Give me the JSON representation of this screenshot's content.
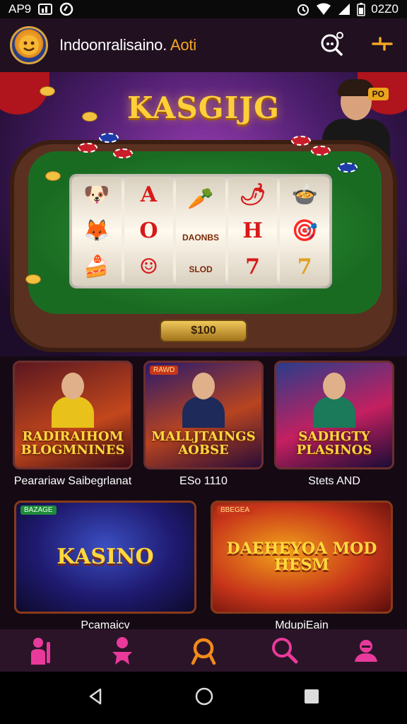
{
  "status_bar": {
    "left_text": "AP9",
    "time": "02Z0"
  },
  "header": {
    "title": "Indoonralisaino.",
    "title_accent": "Aoti",
    "accent_color": "#f5a623"
  },
  "hero": {
    "title": "KASGIJG",
    "badge": "PO",
    "bet_value": "$100",
    "reel_symbols": [
      [
        "🐶",
        "🦊",
        "🍰"
      ],
      [
        "A",
        "O",
        "☺"
      ],
      [
        "🥕",
        "DAONBS",
        "SLOD"
      ],
      [
        "🌶",
        "H",
        "7"
      ],
      [
        "🍲",
        "🎯",
        "7"
      ]
    ]
  },
  "games_row1": [
    {
      "thumb_title": "RADIRAIHOM BLOGMNINES",
      "caption": "Pearariaw Saibegrlanat"
    },
    {
      "thumb_title": "MALLJTAINGS AOBSE",
      "caption": "ESo 1110",
      "tag": "RAWD"
    },
    {
      "thumb_title": "SADHGTY PLASINOS",
      "caption": "Stets AND"
    }
  ],
  "games_row2": [
    {
      "thumb_title": "KASINO",
      "caption": "Pcamaicv",
      "tag": "BAZAGE"
    },
    {
      "thumb_title": "DAEHEYOA MOD HESM",
      "caption": "MdupiEain",
      "tag": "BBEGEA"
    }
  ],
  "bottom_nav": {
    "items": [
      {
        "icon": "player-icon",
        "color": "#e83a9a"
      },
      {
        "icon": "person-icon",
        "color": "#e83a9a"
      },
      {
        "icon": "search-icon",
        "color": "#f28a1a",
        "active": true
      },
      {
        "icon": "magnifier-icon",
        "color": "#e83a9a"
      },
      {
        "icon": "profile-icon",
        "color": "#e83a9a"
      }
    ]
  },
  "system_nav": {
    "items": [
      "back-icon",
      "home-icon",
      "recents-icon"
    ]
  }
}
